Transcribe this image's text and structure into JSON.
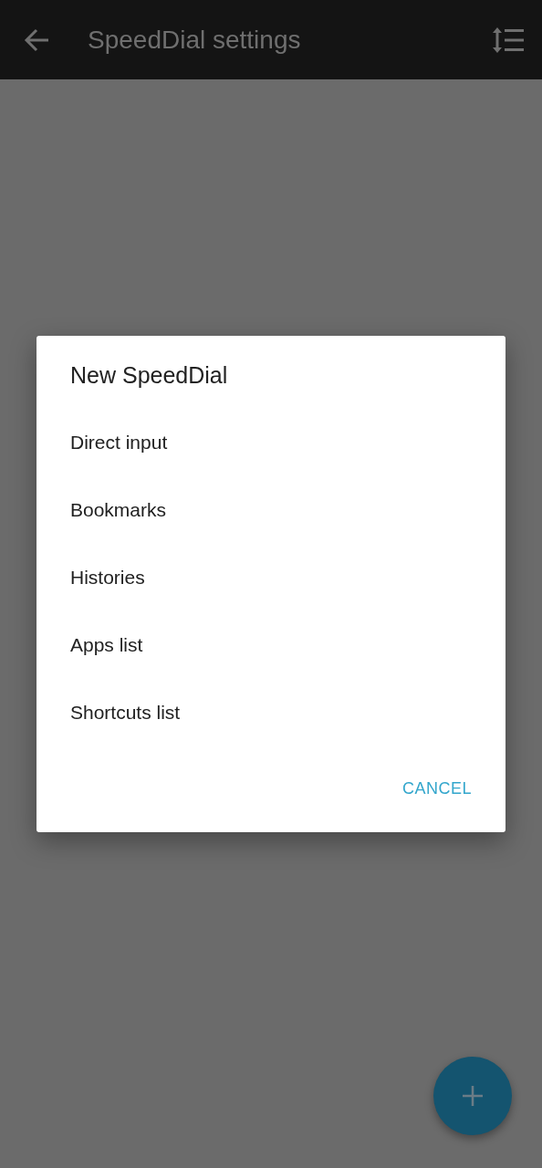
{
  "app_bar": {
    "title": "SpeedDial settings"
  },
  "dialog": {
    "title": "New SpeedDial",
    "options": [
      {
        "label": "Direct input"
      },
      {
        "label": "Bookmarks"
      },
      {
        "label": "Histories"
      },
      {
        "label": "Apps list"
      },
      {
        "label": "Shortcuts list"
      }
    ],
    "buttons": [
      "CANCEL"
    ]
  }
}
